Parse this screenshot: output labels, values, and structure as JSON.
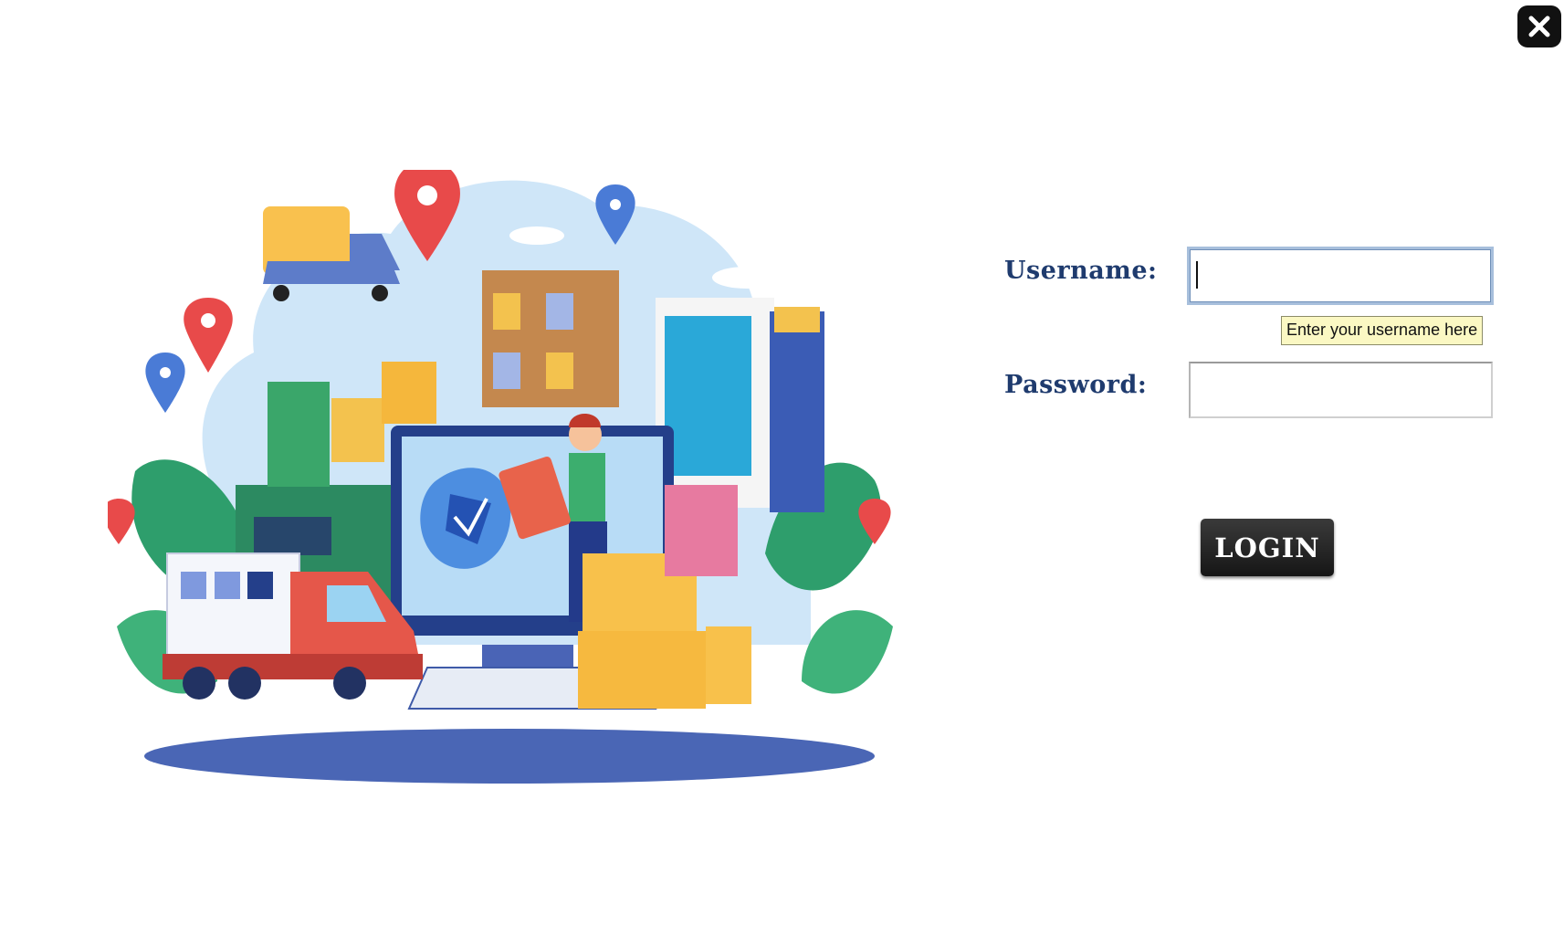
{
  "window": {
    "close_icon": "close-icon"
  },
  "illustration": {
    "subject": "logistics-delivery-illustration"
  },
  "form": {
    "username_label": "Username:",
    "username_value": "",
    "username_placeholder": "",
    "username_tooltip": "Enter your username here",
    "password_label": "Password:",
    "password_value": "",
    "login_label": "LOGIN"
  },
  "colors": {
    "label": "#1f3b6e",
    "button": "#1e1e1e",
    "tooltip_bg": "#fbf8c3"
  }
}
